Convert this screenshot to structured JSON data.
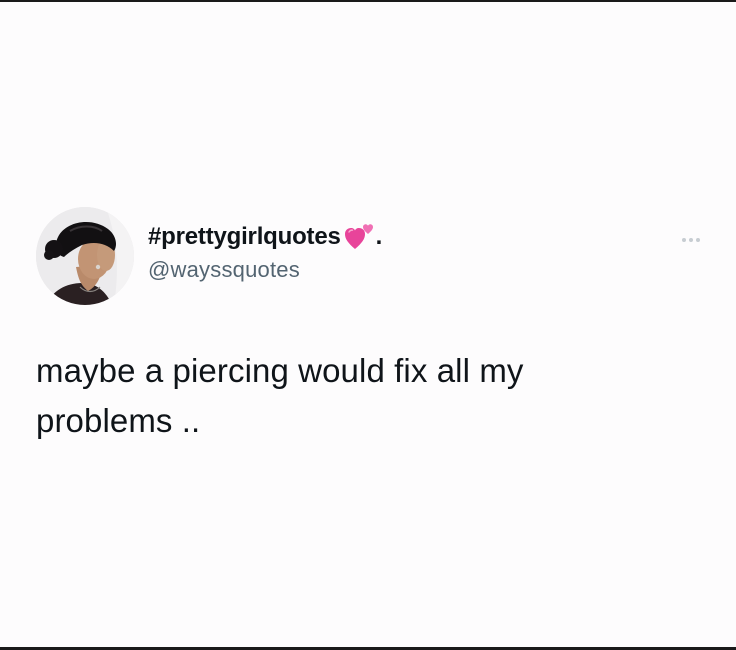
{
  "tweet": {
    "display_name": "#prettygirlquotes",
    "display_name_emoji": "revolving-hearts",
    "display_name_suffix": ".",
    "handle": "@wayssquotes",
    "text_line_1": "maybe a piercing would fix all my",
    "text_line_2": "problems .."
  },
  "icons": {
    "avatar": "profile-photo",
    "more": "more-horizontal-icon"
  },
  "colors": {
    "background": "#fdfcfd",
    "text": "#0f1419",
    "handle": "#536471",
    "heart_pink": "#e8449a",
    "heart_small": "#f06fb4",
    "more_dots": "#c7cdd2"
  }
}
